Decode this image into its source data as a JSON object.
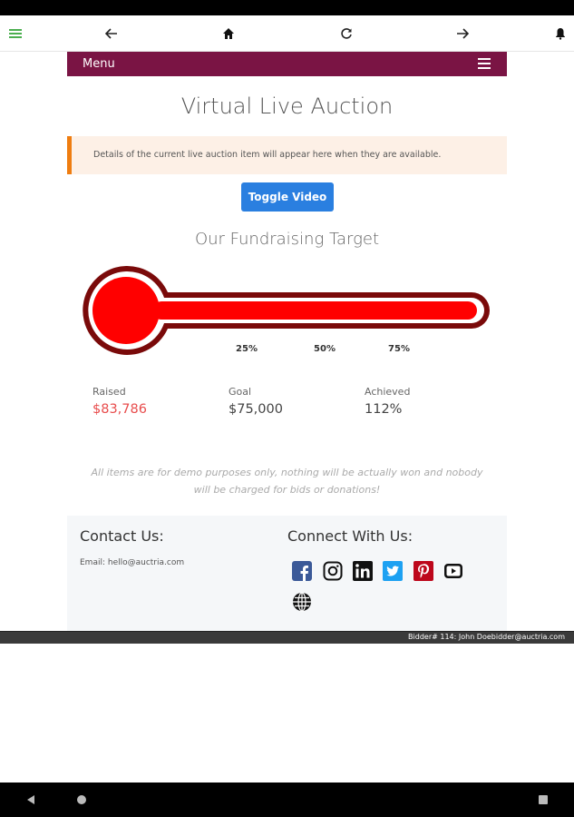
{
  "menu": {
    "label": "Menu"
  },
  "page": {
    "title": "Virtual Live Auction"
  },
  "alert": {
    "text": "Details of the current live auction item will appear here when they are available."
  },
  "toggle_button": {
    "label": "Toggle Video"
  },
  "fundraising": {
    "title": "Our Fundraising Target",
    "progress_percent": 112,
    "ticks": [
      "25%",
      "50%",
      "75%"
    ],
    "stats": [
      {
        "label": "Raised",
        "value": "$83,786"
      },
      {
        "label": "Goal",
        "value": "$75,000"
      },
      {
        "label": "Achieved",
        "value": "112%"
      }
    ]
  },
  "disclaimer": "All items are for demo purposes only, nothing will be actually won and nobody will be charged for bids or donations!",
  "footer": {
    "contact_title": "Contact Us:",
    "email": "Email: hello@auctria.com",
    "connect_title": "Connect With Us:",
    "social": [
      "facebook-icon",
      "instagram-icon",
      "linkedin-icon",
      "twitter-icon",
      "pinterest-icon",
      "youtube-icon",
      "globe-icon"
    ]
  },
  "bidder_bar": {
    "text": "Bidder# 114: John Doebidder@auctria.com"
  },
  "colors": {
    "brand": "#7a1444",
    "accent_blue": "#2a7fe0",
    "alert_border": "#ef7d10",
    "thermo_fill": "#ff0000",
    "thermo_outline": "#7a0a0a",
    "raised_text": "#e84d4d"
  }
}
